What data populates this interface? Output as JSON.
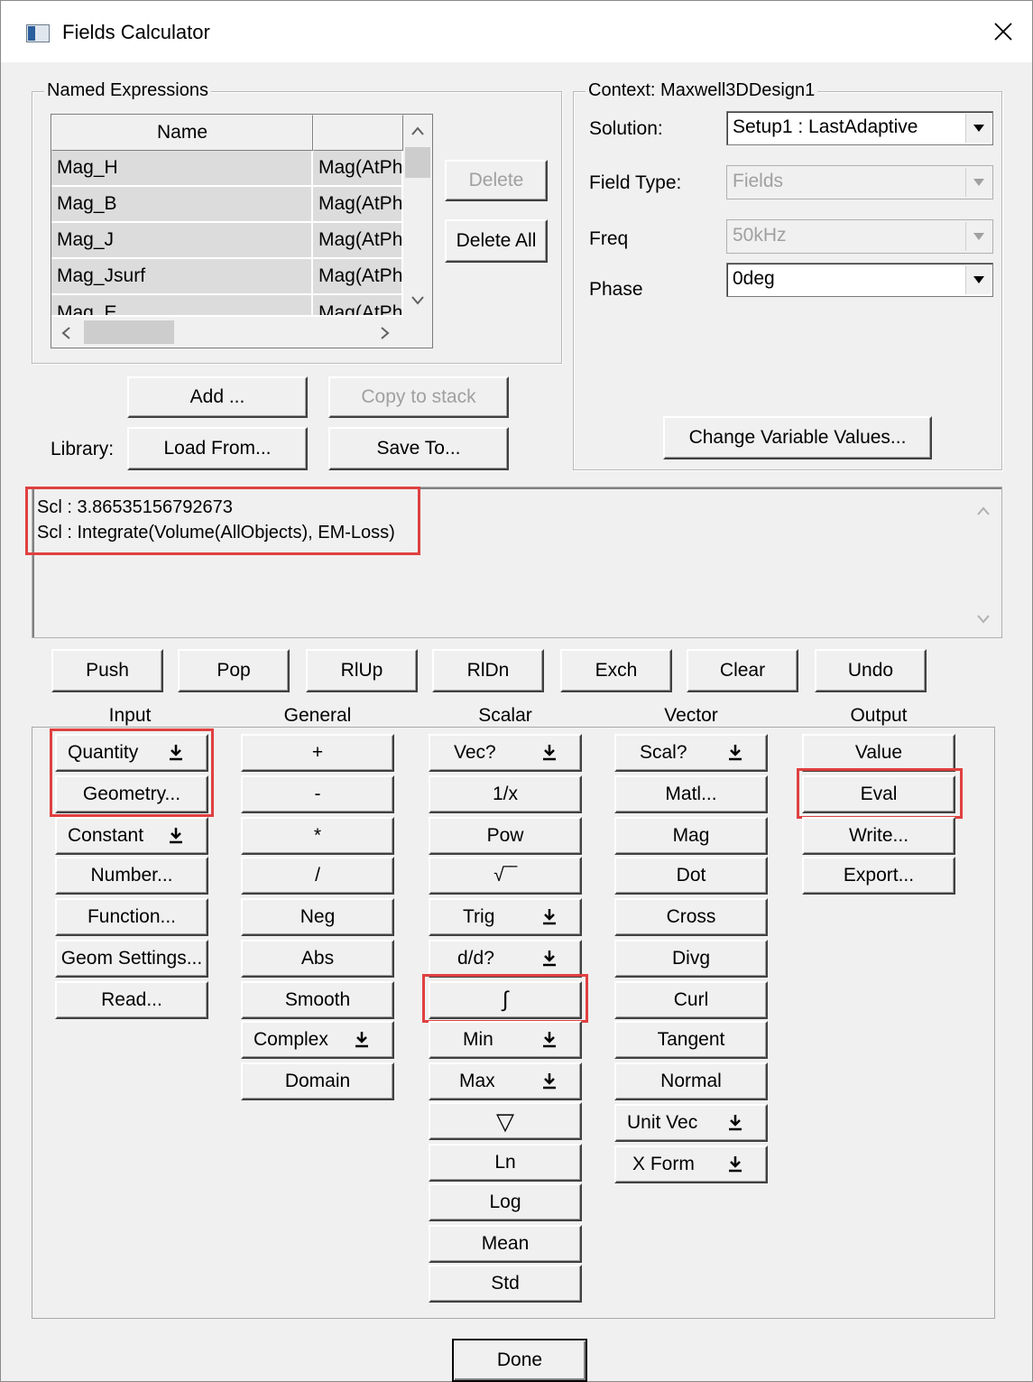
{
  "window": {
    "title": "Fields Calculator"
  },
  "named_expressions": {
    "group_label": "Named Expressions",
    "columns": [
      "Name",
      ""
    ],
    "rows": [
      [
        "Mag_H",
        "Mag(AtPh"
      ],
      [
        "Mag_B",
        "Mag(AtPh"
      ],
      [
        "Mag_J",
        "Mag(AtPh"
      ],
      [
        "Mag_Jsurf",
        "Mag(AtPh"
      ],
      [
        "Mag_E",
        "Mag(AtPh"
      ]
    ],
    "delete_label": "Delete",
    "delete_all_label": "Delete All",
    "add_label": "Add ...",
    "copy_to_stack_label": "Copy to stack",
    "library_label": "Library:",
    "load_from_label": "Load From...",
    "save_to_label": "Save To..."
  },
  "context": {
    "group_label": "Context: Maxwell3DDesign1",
    "solution_label": "Solution:",
    "solution_value": "Setup1 : LastAdaptive",
    "field_type_label": "Field Type:",
    "field_type_value": "Fields",
    "freq_label": "Freq",
    "freq_value": "50kHz",
    "phase_label": "Phase",
    "phase_value": "0deg",
    "change_vars_label": "Change Variable Values..."
  },
  "stack": {
    "lines": [
      "Scl : 3.86535156792673",
      "Scl : Integrate(Volume(AllObjects), EM-Loss)"
    ]
  },
  "stack_buttons": [
    "Push",
    "Pop",
    "RlUp",
    "RlDn",
    "Exch",
    "Clear",
    "Undo"
  ],
  "columns": {
    "input": {
      "label": "Input",
      "buttons": [
        "Quantity",
        "Geometry...",
        "Constant",
        "Number...",
        "Function...",
        "Geom Settings...",
        "Read..."
      ]
    },
    "general": {
      "label": "General",
      "buttons": [
        "+",
        "-",
        "*",
        "/",
        "Neg",
        "Abs",
        "Smooth",
        "Complex",
        "Domain"
      ]
    },
    "scalar": {
      "label": "Scalar",
      "buttons": [
        "Vec?",
        "1/x",
        "Pow",
        "√‾‾",
        "Trig",
        "d/d?",
        "∫",
        "Min",
        "Max",
        "▽",
        "Ln",
        "Log",
        "Mean",
        "Std"
      ]
    },
    "vector": {
      "label": "Vector",
      "buttons": [
        "Scal?",
        "Matl...",
        "Mag",
        "Dot",
        "Cross",
        "Divg",
        "Curl",
        "Tangent",
        "Normal",
        "Unit Vec",
        "X Form"
      ]
    },
    "output": {
      "label": "Output",
      "buttons": [
        "Value",
        "Eval",
        "Write...",
        "Export..."
      ]
    }
  },
  "done_label": "Done",
  "icons": {
    "dropdown": "down-arrow-to-bar-icon",
    "combo": "chevron-down-icon",
    "close": "close-icon"
  },
  "colors": {
    "highlight": "#e04040"
  }
}
